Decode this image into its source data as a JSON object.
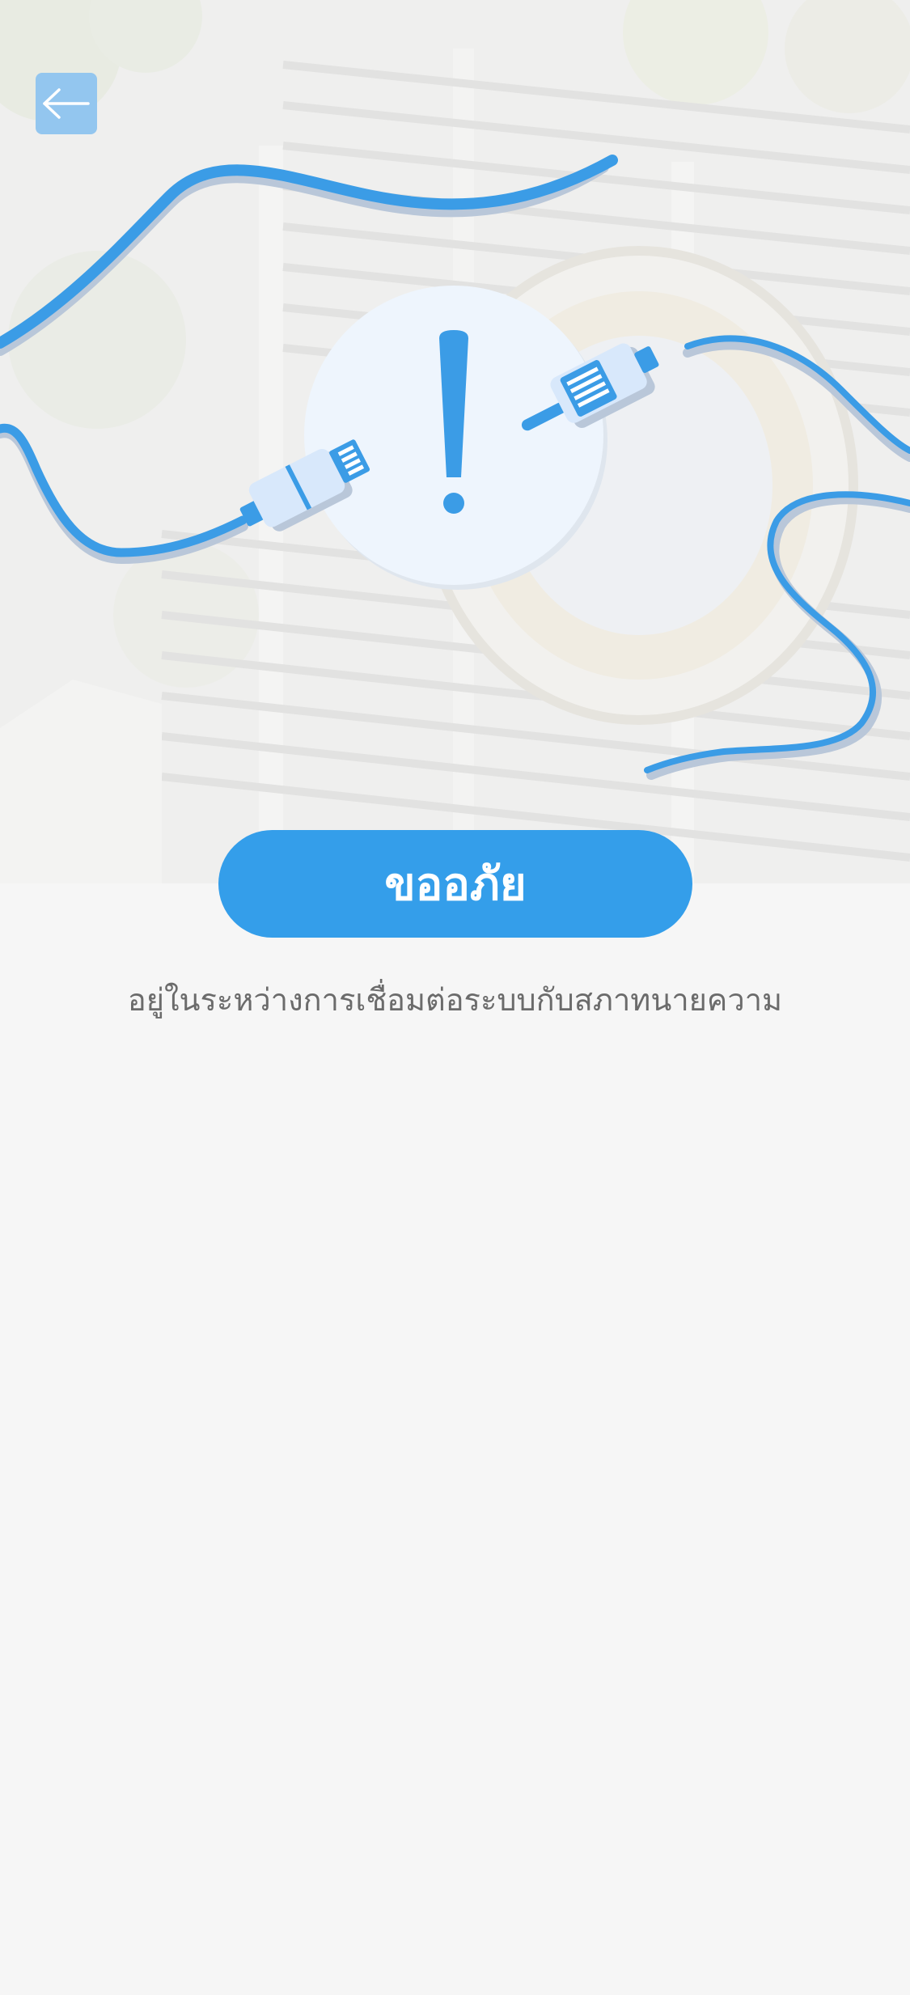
{
  "header": {
    "back_icon": "arrow-left-icon"
  },
  "illustration": {
    "icon": "disconnected-cable-warning-icon",
    "accent": "#349eea",
    "background_subject": "court-building-with-emblem"
  },
  "message": {
    "title": "ขออภัย",
    "body": "อยู่ในระหว่างการเชื่อมต่อระบบกับสภาทนายความ"
  },
  "colors": {
    "primary": "#349eea",
    "page_background": "#f6f6f6",
    "body_text": "#6b6b6b"
  }
}
